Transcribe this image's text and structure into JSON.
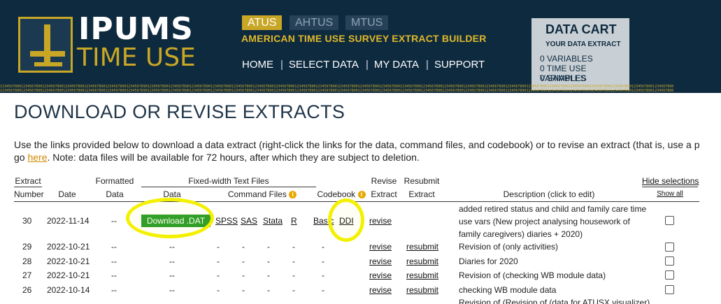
{
  "header": {
    "logo_top": "IPUMS",
    "logo_bottom": "TIME USE",
    "project_tabs": [
      "ATUS",
      "AHTUS",
      "MTUS"
    ],
    "subtitle": "AMERICAN TIME USE SURVEY EXTRACT BUILDER",
    "nav": [
      "HOME",
      "SELECT DATA",
      "MY DATA",
      "SUPPORT"
    ],
    "nav_separator": "|",
    "digits": "12345678901234567890123456789012345678901234567890123456789012345678901234567890123456789012345678901234567890123456789012345678901234567890123456789012345678901234567890123456789012345678901234567890123456789012345678901234567890123456789012345678901234567890123456789012345678901234567890123456789012345678901234567890"
  },
  "cart": {
    "title": "DATA CART",
    "subtitle": "YOUR DATA EXTRACT",
    "lines": [
      "0  VARIABLES",
      "0  TIME USE VARIABLES",
      "0  SAMPLES"
    ]
  },
  "page": {
    "title": "DOWNLOAD OR REVISE EXTRACTS",
    "intro_line1": "Use the links provided below to download a data extract (right-click the links for the data, command files, and codebook) or to revise an extract (that is, use a p",
    "intro_line2_before": "go ",
    "intro_link": "here",
    "intro_line2_after": ". Note: data files will be available for 72 hours, after which they are subject to deletion."
  },
  "table": {
    "headers": {
      "extract_top": "Extract",
      "extract_bottom": "Number",
      "date": "Date",
      "formatted_top": "Formatted",
      "formatted_bottom": "Data",
      "fixed_width": "Fixed-width Text Files",
      "data": "Data",
      "command_files": "Command Files",
      "codebook": "Codebook",
      "revise_top": "Revise",
      "revise_bottom": "Extract",
      "resubmit_top": "Resubmit",
      "resubmit_bottom": "Extract",
      "description": "Description (click to edit)",
      "hide_selections": "Hide selections",
      "show_all": "Show all"
    },
    "info_glyph": "i",
    "rows": [
      {
        "number": "30",
        "date": "2022-11-14",
        "formatted": "--",
        "download": "Download .DAT",
        "spss": "SPSS",
        "sas": "SAS",
        "stata": "Stata",
        "r": "R",
        "codebook_basic": "Basic",
        "codebook_ddi": "DDI",
        "revise": "revise",
        "resubmit": "",
        "description_lines": [
          "added retired status and child and family care time",
          "use vars (New project analysing housework of",
          "family caregivers) diaries + 2020)"
        ]
      },
      {
        "number": "29",
        "date": "2022-10-21",
        "formatted": "--",
        "data": "--",
        "cmd": "-",
        "revise": "revise",
        "resubmit": "resubmit",
        "description": "Revision of (only activities)"
      },
      {
        "number": "28",
        "date": "2022-10-21",
        "formatted": "--",
        "data": "--",
        "cmd": "-",
        "revise": "revise",
        "resubmit": "resubmit",
        "description": "Diaries for 2020"
      },
      {
        "number": "27",
        "date": "2022-10-21",
        "formatted": "--",
        "data": "--",
        "cmd": "-",
        "revise": "revise",
        "resubmit": "resubmit",
        "description": "Revision of (checking WB module data)"
      },
      {
        "number": "26",
        "date": "2022-10-14",
        "formatted": "--",
        "data": "--",
        "cmd": "-",
        "revise": "revise",
        "resubmit": "resubmit",
        "description": "checking WB module data"
      }
    ],
    "partial_row_description": "Revision of (Revision of (data for ATUSX visualizer)"
  },
  "annotation_color": "#f3f000"
}
